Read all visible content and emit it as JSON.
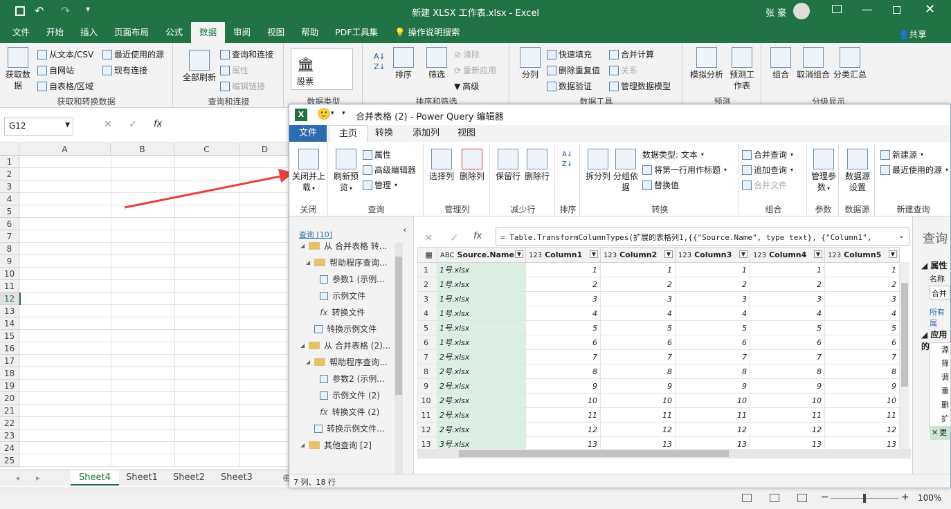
{
  "excel": {
    "title": "新建 XLSX 工作表.xlsx  -  Excel",
    "user": "张 豪",
    "tabs": [
      "文件",
      "开始",
      "插入",
      "页面布局",
      "公式",
      "数据",
      "审阅",
      "视图",
      "帮助",
      "PDF工具集",
      "操作说明搜索"
    ],
    "share": "共享",
    "ribbon": {
      "get_data": "获取数据",
      "from_text": "从文本/CSV",
      "from_web": "自网站",
      "from_table": "自表格/区域",
      "recent": "最近使用的源",
      "existing": "现有连接",
      "group1": "获取和转换数据",
      "refresh_all": "全部刷新",
      "queries_conn": "查询和连接",
      "properties": "属性",
      "edit_links": "编辑链接",
      "group2": "查询和连接",
      "stocks": "股票",
      "group3": "数据类型",
      "sort": "排序",
      "filter": "筛选",
      "clear": "清除",
      "reapply": "重新应用",
      "advanced": "高级",
      "group4": "排序和筛选",
      "split": "分列",
      "flash": "快速填充",
      "remove_dup": "删除重复值",
      "validation": "数据验证",
      "consolidate": "合并计算",
      "relations": "关系",
      "model": "管理数据模型",
      "group5": "数据工具",
      "whatif": "模拟分析",
      "forecast": "预测工作表",
      "group6": "预测",
      "group_btn": "组合",
      "ungroup": "取消组合",
      "subtotal": "分类汇总",
      "group7": "分级显示"
    },
    "namebox": "G12",
    "columns": [
      "A",
      "B",
      "C",
      "D"
    ],
    "rows": [
      "1",
      "2",
      "3",
      "4",
      "5",
      "6",
      "7",
      "8",
      "9",
      "10",
      "11",
      "12",
      "13",
      "14",
      "15",
      "16",
      "17",
      "18",
      "19",
      "20",
      "21",
      "22",
      "23",
      "24",
      "25"
    ],
    "sheets": [
      "Sheet4",
      "Sheet1",
      "Sheet2",
      "Sheet3"
    ],
    "zoom": "100%"
  },
  "pq": {
    "title": "合并表格 (2) - Power Query 编辑器",
    "tabs": [
      "文件",
      "主页",
      "转换",
      "添加列",
      "视图"
    ],
    "ribbon": {
      "close_load": "关闭并上载",
      "g_close": "关闭",
      "refresh": "刷新预览",
      "properties": "属性",
      "adv_editor": "高级编辑器",
      "manage": "管理",
      "g_query": "查询",
      "choose_cols": "选择列",
      "remove_cols": "删除列",
      "g_manage_cols": "管理列",
      "keep_rows": "保留行",
      "remove_rows": "删除行",
      "g_reduce": "减少行",
      "g_sort": "排序",
      "split_col": "拆分列",
      "group_by": "分组依据",
      "data_type": "数据类型: 文本",
      "first_row": "将第一行用作标题",
      "replace": "替换值",
      "g_transform": "转换",
      "merge": "合并查询",
      "append": "追加查询",
      "combine": "合并文件",
      "g_combine": "组合",
      "manage_params": "管理参数",
      "g_params": "参数",
      "ds_settings": "数据源设置",
      "g_ds": "数据源",
      "new_source": "新建源",
      "recent_source": "最近使用的源",
      "g_new": "新建查询"
    },
    "queries_header": "查询 [10]",
    "queries": [
      "从 合并表格 转...",
      "帮助程序查询...",
      "参数1 (示例...",
      "示例文件",
      "转换文件",
      "转换示例文件",
      "从 合并表格 (2)...",
      "帮助程序查询...",
      "参数2 (示例...",
      "示例文件 (2)",
      "转换文件 (2)",
      "转换示例文件...",
      "其他查询 [2]"
    ],
    "formula": "= Table.TransformColumnTypes(扩展的表格列1,{{\"Source.Name\", type text}, {\"Column1\",",
    "headers": [
      "Source.Name",
      "Column1",
      "Column2",
      "Column3",
      "Column4",
      "Column5"
    ],
    "rows": [
      [
        "1",
        "1号.xlsx",
        "1",
        "1",
        "1",
        "1",
        "1"
      ],
      [
        "2",
        "1号.xlsx",
        "2",
        "2",
        "2",
        "2",
        "2"
      ],
      [
        "3",
        "1号.xlsx",
        "3",
        "3",
        "3",
        "3",
        "3"
      ],
      [
        "4",
        "1号.xlsx",
        "4",
        "4",
        "4",
        "4",
        "4"
      ],
      [
        "5",
        "1号.xlsx",
        "5",
        "5",
        "5",
        "5",
        "5"
      ],
      [
        "6",
        "1号.xlsx",
        "6",
        "6",
        "6",
        "6",
        "6"
      ],
      [
        "7",
        "2号.xlsx",
        "7",
        "7",
        "7",
        "7",
        "7"
      ],
      [
        "8",
        "2号.xlsx",
        "8",
        "8",
        "8",
        "8",
        "8"
      ],
      [
        "9",
        "2号.xlsx",
        "9",
        "9",
        "9",
        "9",
        "9"
      ],
      [
        "10",
        "2号.xlsx",
        "10",
        "10",
        "10",
        "10",
        "10"
      ],
      [
        "11",
        "2号.xlsx",
        "11",
        "11",
        "11",
        "11",
        "11"
      ],
      [
        "12",
        "2号.xlsx",
        "12",
        "12",
        "12",
        "12",
        "12"
      ],
      [
        "13",
        "3号.xlsx",
        "13",
        "13",
        "13",
        "13",
        "13"
      ]
    ],
    "right_title": "查询",
    "right_props": "属性",
    "right_name": "名称",
    "right_name_val": "合并",
    "right_all": "所有属",
    "right_applied": "应用的",
    "right_steps": [
      "源",
      "筛",
      "调",
      "重",
      "删",
      "扩",
      "更"
    ],
    "status": "7 列、18 行"
  },
  "colors": {
    "excel_green": "#217346",
    "arrow": "#e8403a",
    "pq_accent": "#2b6cb0"
  }
}
